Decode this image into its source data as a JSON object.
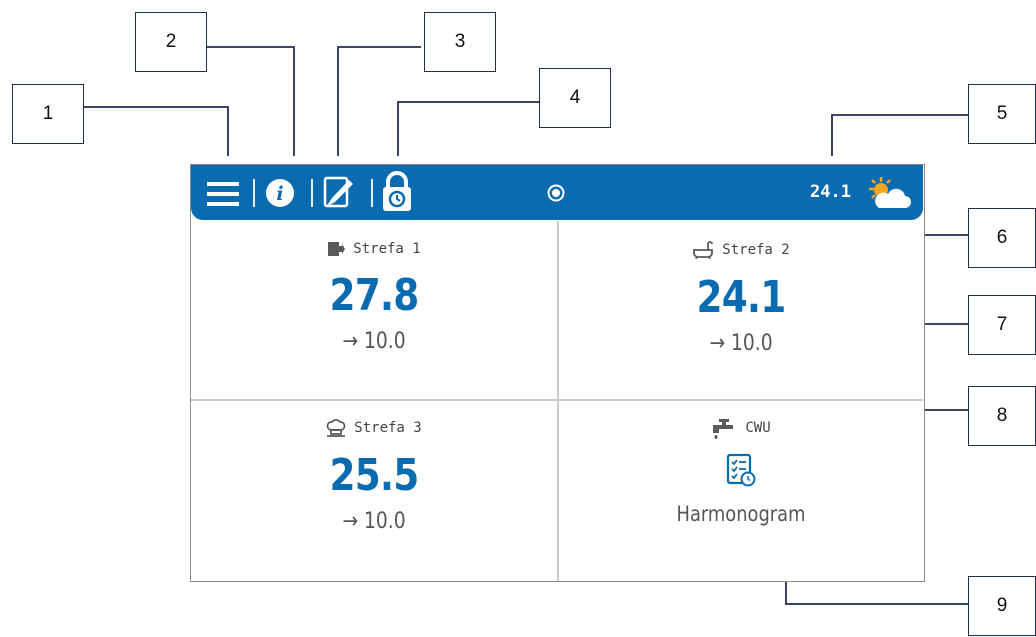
{
  "callouts": [
    "1",
    "2",
    "3",
    "4",
    "5",
    "6",
    "7",
    "8",
    "9"
  ],
  "topbar": {
    "outdoor_temp": "24.1",
    "icons": [
      "menu-icon",
      "info-icon",
      "edit-icon",
      "lock-icon",
      "mode-dot-icon",
      "weather-icon"
    ]
  },
  "zones": [
    {
      "name": "Strefa 1",
      "temp": "27.8",
      "setpoint": "→ 10.0",
      "icon": "door-icon"
    },
    {
      "name": "Strefa 2",
      "temp": "24.1",
      "setpoint": "→ 10.0",
      "icon": "bathtub-icon"
    },
    {
      "name": "Strefa 3",
      "temp": "25.5",
      "setpoint": "→ 10.0",
      "icon": "chef-hat-icon"
    }
  ],
  "cwu": {
    "name": "CWU",
    "schedule_label": "Harmonogram",
    "icon": "faucet-icon"
  },
  "colors": {
    "accent": "#0a6bb0",
    "callout_border": "#1f2f4f",
    "grid": "#c8c8c8",
    "sun": "#f5a623"
  }
}
